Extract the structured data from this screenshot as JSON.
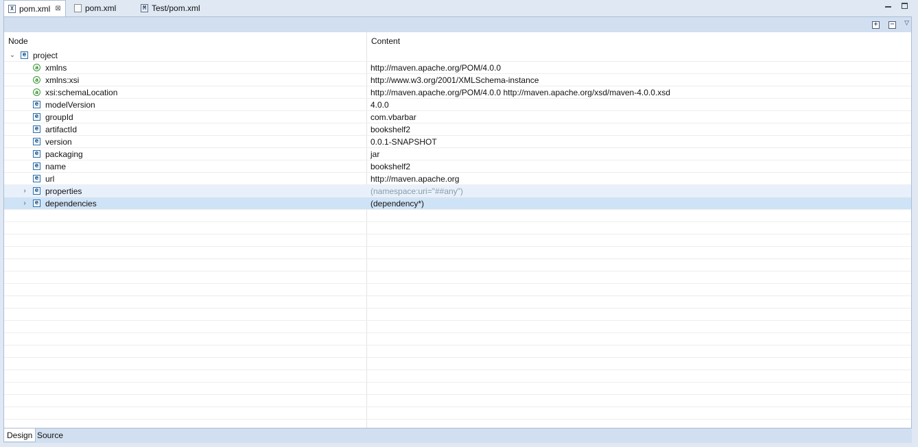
{
  "tabs": [
    {
      "label": "pom.xml",
      "icon": "xml-file-icon",
      "active": true,
      "closable": true
    },
    {
      "label": "pom.xml",
      "icon": "text-file-icon",
      "active": false,
      "closable": false
    },
    {
      "label": "Test/pom.xml",
      "icon": "maven-file-icon",
      "active": false,
      "closable": false
    }
  ],
  "columns": {
    "node": "Node",
    "content": "Content"
  },
  "tree": [
    {
      "depth": 0,
      "twisty": "expanded",
      "kind": "element",
      "name": "project",
      "content": ""
    },
    {
      "depth": 1,
      "twisty": "none",
      "kind": "attribute",
      "name": "xmlns",
      "content": "http://maven.apache.org/POM/4.0.0"
    },
    {
      "depth": 1,
      "twisty": "none",
      "kind": "attribute",
      "name": "xmlns:xsi",
      "content": "http://www.w3.org/2001/XMLSchema-instance"
    },
    {
      "depth": 1,
      "twisty": "none",
      "kind": "attribute",
      "name": "xsi:schemaLocation",
      "content": "http://maven.apache.org/POM/4.0.0 http://maven.apache.org/xsd/maven-4.0.0.xsd"
    },
    {
      "depth": 1,
      "twisty": "none",
      "kind": "element",
      "name": "modelVersion",
      "content": "4.0.0"
    },
    {
      "depth": 1,
      "twisty": "none",
      "kind": "element",
      "name": "groupId",
      "content": "com.vbarbar"
    },
    {
      "depth": 1,
      "twisty": "none",
      "kind": "element",
      "name": "artifactId",
      "content": "bookshelf2"
    },
    {
      "depth": 1,
      "twisty": "none",
      "kind": "element",
      "name": "version",
      "content": "0.0.1-SNAPSHOT"
    },
    {
      "depth": 1,
      "twisty": "none",
      "kind": "element",
      "name": "packaging",
      "content": "jar"
    },
    {
      "depth": 1,
      "twisty": "none",
      "kind": "element",
      "name": "name",
      "content": "bookshelf2"
    },
    {
      "depth": 1,
      "twisty": "none",
      "kind": "element",
      "name": "url",
      "content": "http://maven.apache.org"
    },
    {
      "depth": 1,
      "twisty": "collapsed",
      "kind": "element",
      "name": "properties",
      "content": "(namespace:uri=\"##any\")",
      "hint": true,
      "state": "hover"
    },
    {
      "depth": 1,
      "twisty": "collapsed",
      "kind": "element",
      "name": "dependencies",
      "content": "(dependency*)",
      "state": "selected"
    }
  ],
  "bottom_tabs": [
    {
      "label": "Design",
      "active": true
    },
    {
      "label": "Source",
      "active": false
    }
  ],
  "icons": {
    "element_glyph": "e",
    "attribute_glyph": "a",
    "expand_all": "+",
    "collapse_all": "−",
    "xml_glyph": "X",
    "maven_glyph": "M"
  },
  "colors": {
    "selected_row": "#cfe3f7",
    "hover_row": "#e8f1fb",
    "chrome": "#dfe8f3",
    "toolbar": "#d1dff0"
  }
}
